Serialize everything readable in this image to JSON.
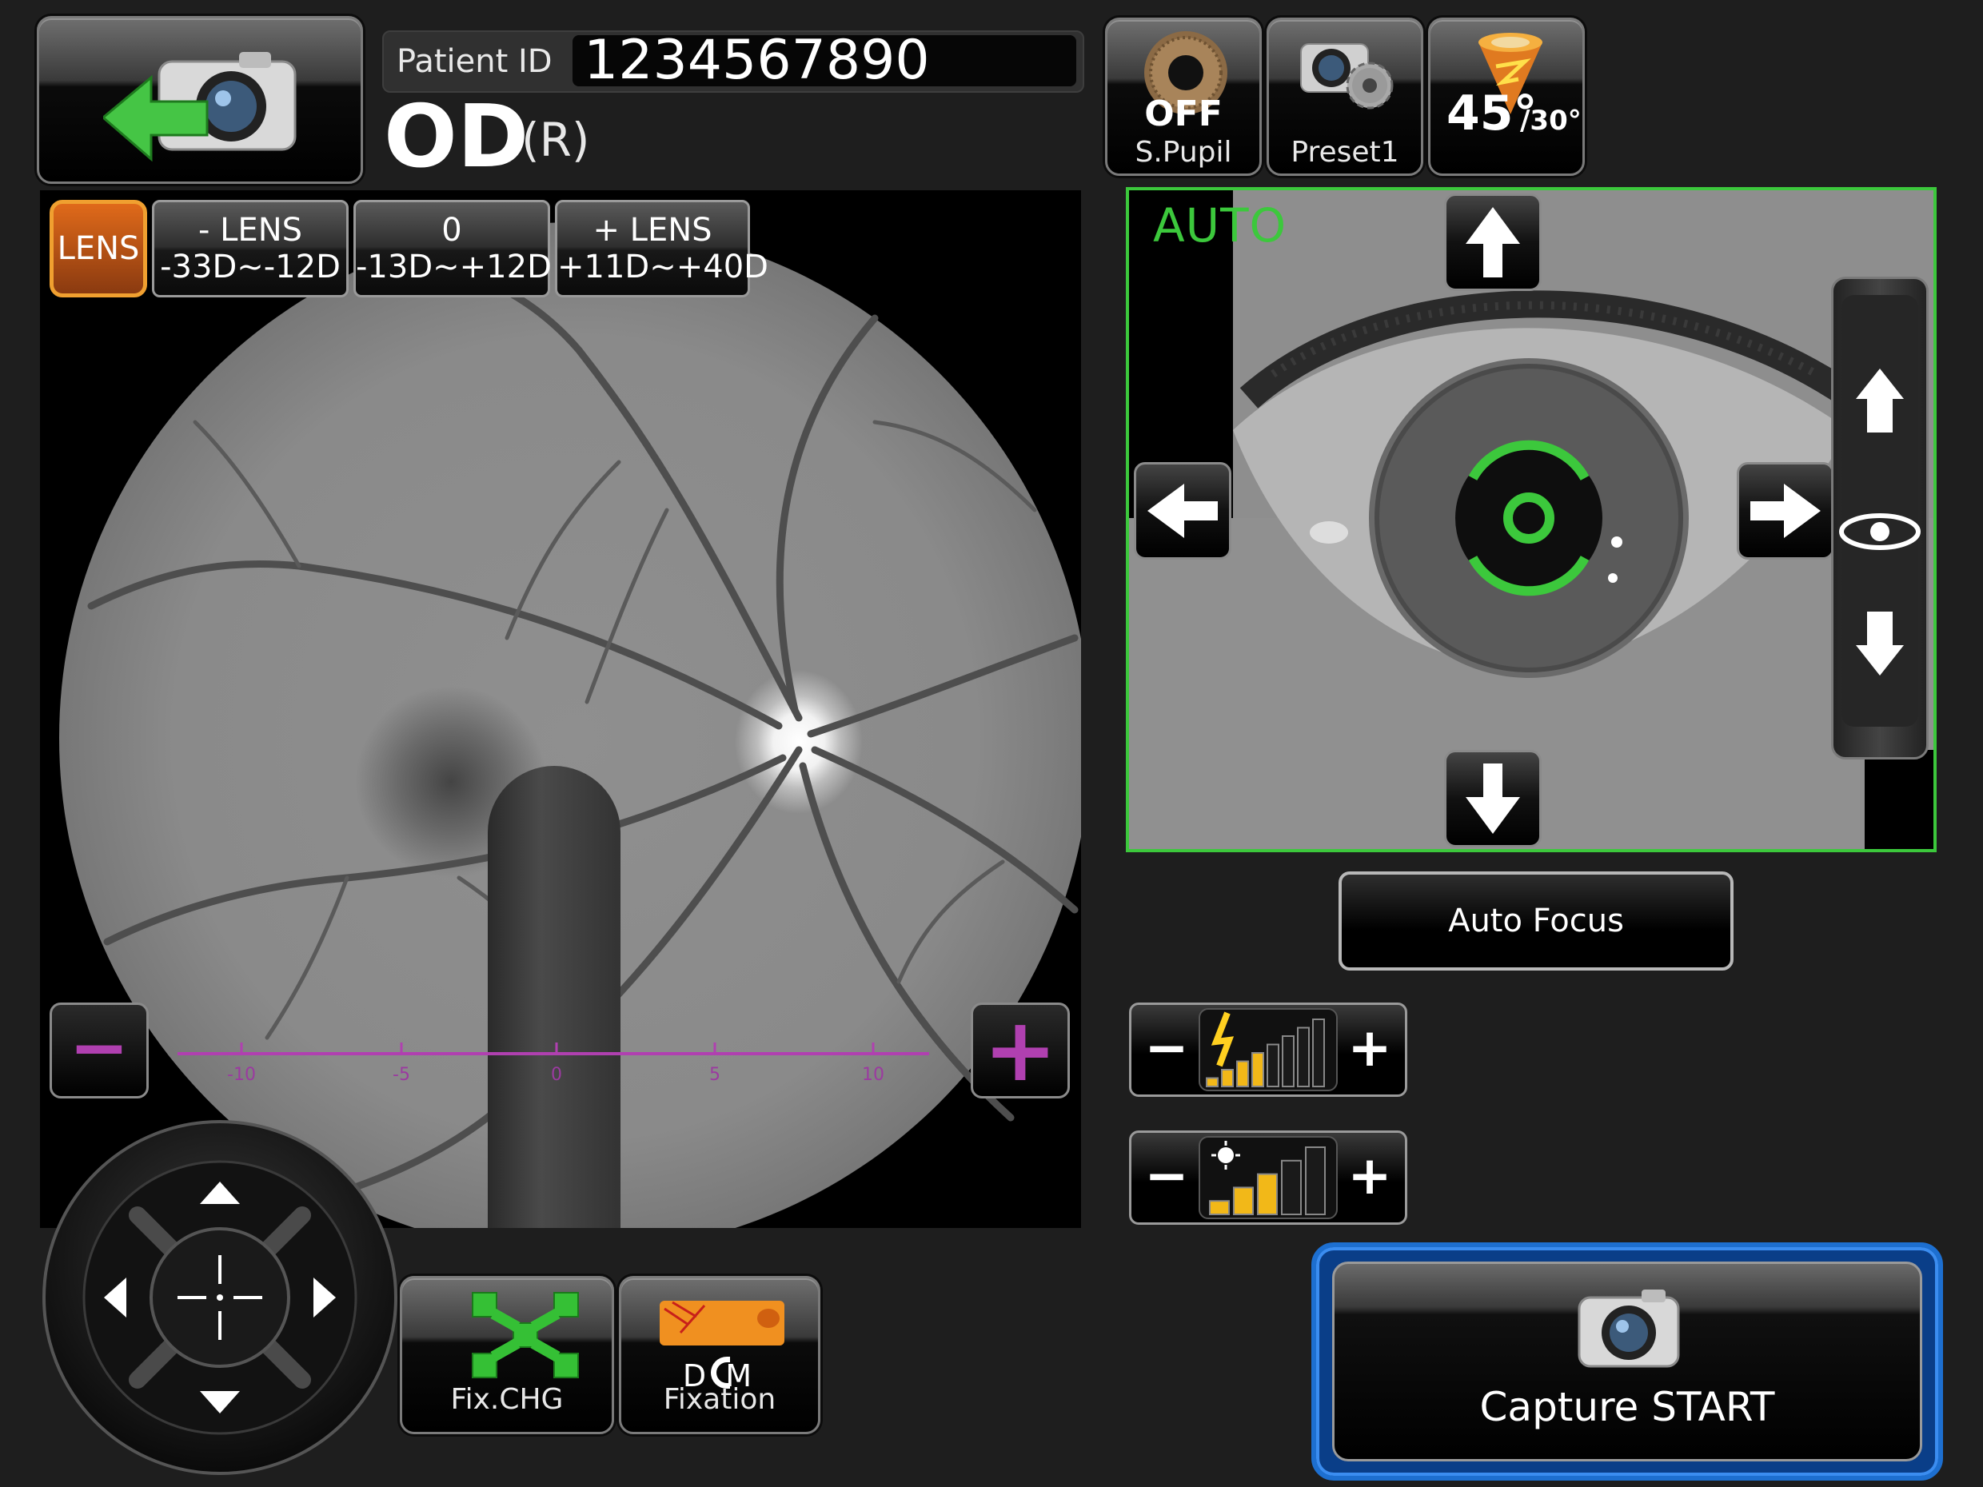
{
  "header": {
    "patient_id_label": "Patient ID",
    "patient_id_value": "1234567890",
    "eye": "OD",
    "eye_side": "(R)"
  },
  "tools": {
    "small_pupil": {
      "state": "OFF",
      "label": "S.Pupil"
    },
    "preset": {
      "label": "Preset1"
    },
    "angle": {
      "primary": "45°",
      "secondary": "/30°"
    }
  },
  "lens": {
    "toggle_label": "LENS",
    "options": [
      {
        "title": "- LENS",
        "range": "-33D~-12D"
      },
      {
        "title": "0",
        "range": "-13D~+12D"
      },
      {
        "title": "+ LENS",
        "range": "+11D~+40D"
      }
    ]
  },
  "focus_scale": {
    "ticks": [
      "-10",
      "-5",
      "0",
      "5",
      "10"
    ],
    "minus": "−",
    "plus": "+"
  },
  "anterior": {
    "mode_label": "AUTO"
  },
  "auto_focus_label": "Auto Focus",
  "levels": {
    "flash": {
      "minus": "−",
      "plus": "+",
      "level": 4,
      "max": 8
    },
    "observation_light": {
      "minus": "−",
      "plus": "+",
      "level": 3,
      "max": 5
    }
  },
  "fixation": {
    "change_label": "Fix.CHG",
    "mode_letters": "D  M",
    "mode_label": "Fixation"
  },
  "capture": {
    "label": "Capture START"
  },
  "colors": {
    "accent_green": "#3cc83c",
    "lens_orange": "#e06a1a",
    "scale_purple": "#b040b0",
    "capture_blue": "#1d6fd0"
  }
}
